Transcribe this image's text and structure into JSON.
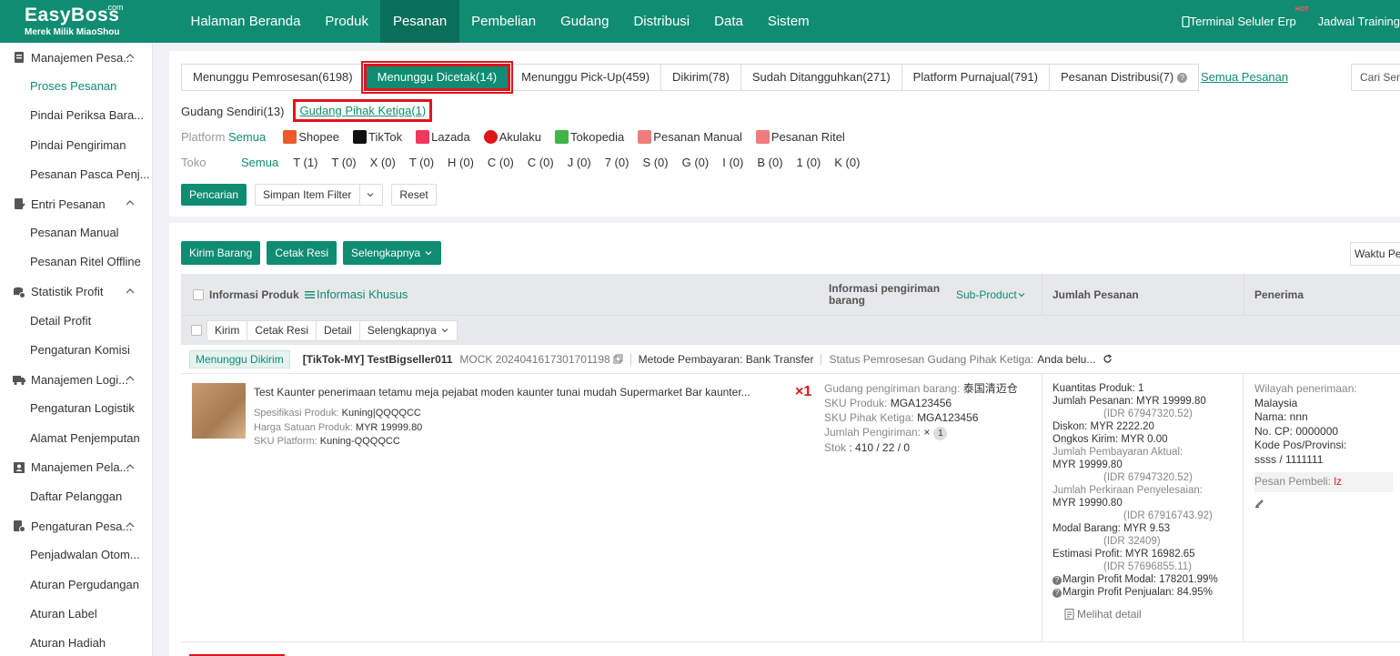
{
  "brand": {
    "name": "EasyBoss",
    "com": ".com",
    "sub": "Merek Milik MiaoShou"
  },
  "nav": [
    {
      "label": "Halaman Beranda"
    },
    {
      "label": "Produk"
    },
    {
      "label": "Pesanan",
      "active": true
    },
    {
      "label": "Pembelian"
    },
    {
      "label": "Gudang"
    },
    {
      "label": "Distribusi"
    },
    {
      "label": "Data"
    },
    {
      "label": "Sistem"
    }
  ],
  "top_right": {
    "terminal": "Terminal Seluler Erp",
    "hot": "HOT",
    "training": "Jadwal Training"
  },
  "sidebar": {
    "g1": "Manajemen Pesa...",
    "g1_items": [
      "Proses Pesanan",
      "Pindai Periksa Bara...",
      "Pindai Pengiriman",
      "Pesanan Pasca Penj..."
    ],
    "g2": "Entri Pesanan",
    "g2_items": [
      "Pesanan Manual",
      "Pesanan Ritel Offline"
    ],
    "g3": "Statistik Profit",
    "g3_items": [
      "Detail Profit",
      "Pengaturan Komisi"
    ],
    "g4": "Manajemen Logi...",
    "g4_items": [
      "Pengaturan Logistik",
      "Alamat Penjemputan"
    ],
    "g5": "Manajemen Pela...",
    "g5_items": [
      "Daftar Pelanggan"
    ],
    "g6": "Pengaturan Pesa...",
    "g6_items": [
      "Penjadwalan Otom...",
      "Aturan Pergudangan",
      "Aturan Label",
      "Aturan Hadiah"
    ]
  },
  "tabs": [
    "Menunggu Pemrosesan(6198)",
    "Menunggu Dicetak(14)",
    "Menunggu Pick-Up(459)",
    "Dikirim(78)",
    "Sudah Ditangguhkan(271)",
    "Platform Purnajual(791)",
    "Pesanan Distribusi(7)"
  ],
  "semua_pesanan": "Semua Pesanan",
  "cari": "Cari Semua",
  "subtabs": {
    "sendiri": "Gudang Sendiri(13)",
    "pihak": "Gudang Pihak Ketiga(1)"
  },
  "platform": {
    "label": "Platform",
    "all": "Semua",
    "items": [
      "Shopee",
      "TikTok",
      "Lazada",
      "Akulaku",
      "Tokopedia",
      "Pesanan Manual",
      "Pesanan Ritel"
    ],
    "colors": [
      "#f0592a",
      "#111111",
      "#f2375e",
      "#e0141a",
      "#42b549",
      "#f07c7c",
      "#f07c7c"
    ]
  },
  "toko": {
    "label": "Toko",
    "all": "Semua",
    "items": [
      "T (1)",
      "T (0)",
      "X (0)",
      "T (0)",
      "H (0)",
      "C (0)",
      "C (0)",
      "J (0)",
      "7 (0)",
      "S (0)",
      "G (0)",
      "I (0)",
      "B (0)",
      "1 (0)",
      "K (0)"
    ]
  },
  "buttons": {
    "pencarian": "Pencarian",
    "simpan": "Simpan Item Filter",
    "reset": "Reset"
  },
  "actions": {
    "kirim": "Kirim Barang",
    "cetak": "Cetak Resi",
    "more": "Selengkapnya"
  },
  "waktu": "Waktu Pesanan",
  "thead": {
    "info_produk": "Informasi Produk",
    "info_khusus": "Informasi Khusus",
    "info_kirim": "Informasi pengiriman barang",
    "sub_product": "Sub-Product",
    "jumlah": "Jumlah Pesanan",
    "penerima": "Penerima"
  },
  "subbar": [
    "Kirim",
    "Cetak Resi",
    "Detail",
    "Selengkapnya"
  ],
  "order": {
    "status": "Menunggu Dikirim",
    "id": "[TikTok-MY]  TestBigseller011",
    "mock": "MOCK 2024041617301701198",
    "payment": "Metode Pembayaran: Bank Transfer",
    "proc_status": "Status Pemrosesan Gudang Pihak Ketiga:",
    "proc_value": "Anda belu...",
    "product_title": "Test Kaunter penerimaan tetamu meja pejabat moden kaunter tunai mudah Supermarket Bar kaunter...",
    "qty_mark": "×1",
    "spec_k": "Spesifikasi Produk:",
    "spec_v": "Kuning|QQQQCC",
    "price_k": "Harga Satuan Produk:",
    "price_v": "MYR 19999.80",
    "sku_k": "SKU Platform:",
    "sku_v": "Kuning-QQQQCC",
    "ship": {
      "gudang_k": "Gudang pengiriman barang:",
      "gudang_v": "泰国清迈仓",
      "sku_k": "SKU Produk:",
      "sku_v": "MGA123456",
      "sku3_k": "SKU Pihak Ketiga:",
      "sku3_v": "MGA123456",
      "jml_k": "Jumlah Pengiriman:",
      "jml_v": "×",
      "jml_n": "1",
      "stok_k": "Stok",
      "stok_v": ":   410 / 22 / 0"
    },
    "amount": {
      "kuantitas": "Kuantitas Produk:  1",
      "jumlah": "Jumlah Pesanan:  MYR 19999.80",
      "jumlah_idr": "(IDR 67947320.52)",
      "diskon": "Diskon:  MYR 2222.20",
      "ongkos": "Ongkos Kirim:  MYR 0.00",
      "bayar_k": "Jumlah Pembayaran Aktual:",
      "bayar_v": "MYR 19999.80",
      "bayar_idr": "(IDR 67947320.52)",
      "perkiraan_k": "Jumlah Perkiraan Penyelesaian:",
      "perkiraan_v": "MYR 19990.80",
      "perkiraan_idr": "(IDR 67916743.92)",
      "modal": "Modal Barang:  MYR 9.53",
      "modal_idr": "(IDR 32409)",
      "estimasi": "Estimasi Profit:  MYR 16982.65",
      "estimasi_idr": "(IDR 57696855.11)",
      "margin_modal": "Margin Profit Modal:  178201.99%",
      "margin_jual": "Margin Profit Penjualan:  84.95%",
      "detail": "Melihat detail"
    },
    "receiver": {
      "wilayah_k": "Wilayah penerimaan:",
      "wilayah_v": "Malaysia",
      "nama": "Nama:  nnn",
      "cp": "No. CP:  0000000",
      "kode_k": "Kode Pos/Provinsi:",
      "kode_v": "ssss / 1111111",
      "pesan_k": "Pesan Pembeli:",
      "pesan_v": "lz"
    }
  }
}
